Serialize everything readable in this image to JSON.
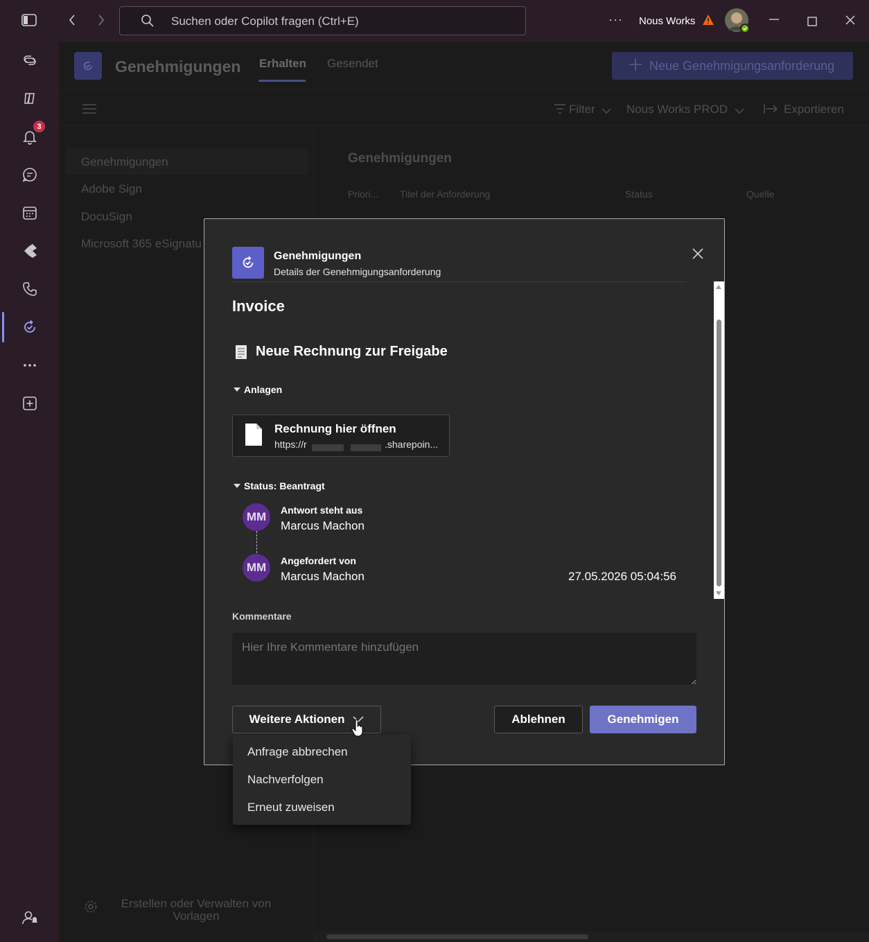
{
  "titlebar": {
    "search_placeholder": "Suchen oder Copilot fragen (Ctrl+E)",
    "org_name": "Nous Works",
    "more": "···"
  },
  "rail": {
    "notification_count": "3"
  },
  "app": {
    "title": "Genehmigungen",
    "tabs": [
      {
        "label": "Erhalten",
        "active": true
      },
      {
        "label": "Gesendet",
        "active": false
      }
    ],
    "new_request_label": "Neue Genehmigungsanforderung",
    "toolbar": {
      "filter_label": "Filter",
      "environment_label": "Nous Works PROD",
      "export_label": "Exportieren"
    },
    "sidenav": {
      "items": [
        "Genehmigungen",
        "Adobe Sign",
        "DocuSign",
        "Microsoft 365 eSignatu"
      ],
      "footer": "Erstellen oder Verwalten von Vorlagen"
    },
    "content": {
      "title": "Genehmigungen",
      "columns": [
        "Priori...",
        "Titel der Anforderung",
        "Status",
        "Quelle"
      ]
    }
  },
  "dialog": {
    "app_name": "Genehmigungen",
    "subtitle": "Details der Genehmigungsanforderung",
    "title": "Invoice",
    "request_title": "Neue Rechnung zur Freigabe",
    "attachments_label": "Anlagen",
    "attachment": {
      "title": "Rechnung hier öffnen",
      "url_start": "https://r",
      "url_end": ".sharepoin..."
    },
    "status_label": "Status: Beantragt",
    "approvers": [
      {
        "initials": "MM",
        "label": "Antwort steht aus",
        "name": "Marcus Machon",
        "time": ""
      },
      {
        "initials": "MM",
        "label": "Angefordert von",
        "name": "Marcus Machon",
        "time": "27.05.2026 05:04:56"
      }
    ],
    "comments_label": "Kommentare",
    "comments_placeholder": "Hier Ihre Kommentare hinzufügen",
    "more_actions_label": "Weitere Aktionen",
    "reject_label": "Ablehnen",
    "approve_label": "Genehmigen",
    "menu_items": [
      "Anfrage abbrechen",
      "Nachverfolgen",
      "Erneut zuweisen"
    ]
  },
  "colors": {
    "accent": "#5b5fc7",
    "avatar": "#5c2d91",
    "badge": "#c4314b",
    "warning": "#f7630c"
  }
}
